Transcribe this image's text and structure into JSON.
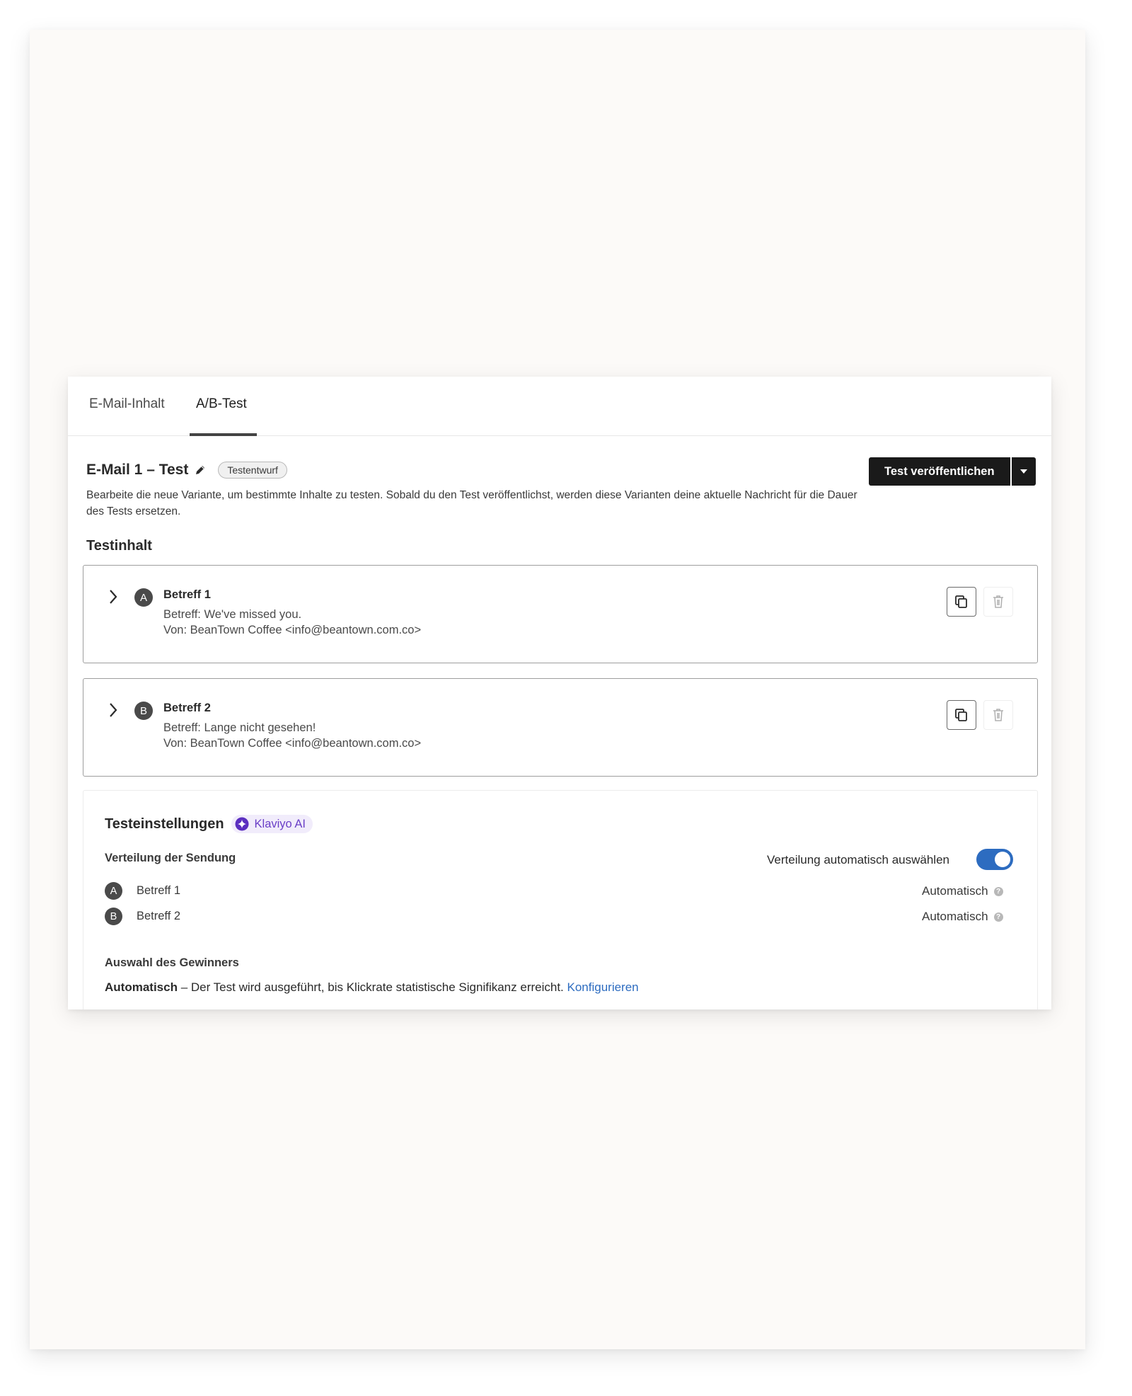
{
  "tabs": [
    {
      "label": "E-Mail-Inhalt",
      "active": false
    },
    {
      "label": "A/B-Test",
      "active": true
    }
  ],
  "header": {
    "title": "E-Mail 1 – Test",
    "status_badge": "Testentwurf",
    "description": "Bearbeite die neue Variante, um bestimmte Inhalte zu testen. Sobald du den Test veröffentlichst, werden diese Varianten deine aktuelle Nachricht für die Dauer des Tests ersetzen.",
    "publish_label": "Test veröffentlichen"
  },
  "content_section": {
    "title": "Testinhalt",
    "variants": [
      {
        "letter": "A",
        "name": "Betreff 1",
        "subject": "Betreff: We've missed you.",
        "from": "Von: BeanTown Coffee <info@beantown.com.co>"
      },
      {
        "letter": "B",
        "name": "Betreff 2",
        "subject": "Betreff: Lange nicht gesehen!",
        "from": "Von: BeanTown Coffee <info@beantown.com.co>"
      }
    ]
  },
  "settings": {
    "title": "Testeinstellungen",
    "ai_badge": "Klaviyo AI",
    "distribution_label": "Verteilung der Sendung",
    "auto_toggle_label": "Verteilung automatisch auswählen",
    "auto_toggle_on": true,
    "distribution": [
      {
        "letter": "A",
        "name": "Betreff 1",
        "value": "Automatisch"
      },
      {
        "letter": "B",
        "name": "Betreff 2",
        "value": "Automatisch"
      }
    ],
    "winner_label": "Auswahl des Gewinners",
    "winner_mode": "Automatisch",
    "winner_text": " – Der Test wird ausgeführt, bis Klickrate statistische Signifikanz erreicht. ",
    "winner_link": "Konfigurieren"
  },
  "colors": {
    "accent": "#2d6cc0",
    "ai_purple": "#6a3fc7",
    "panel_bg": "#fcfaf8",
    "primary_button": "#1a1a1a"
  },
  "icons": [
    "pencil-icon",
    "chevron-right-icon",
    "copy-icon",
    "trash-icon",
    "sparkle-icon",
    "help-icon",
    "caret-down-icon"
  ]
}
